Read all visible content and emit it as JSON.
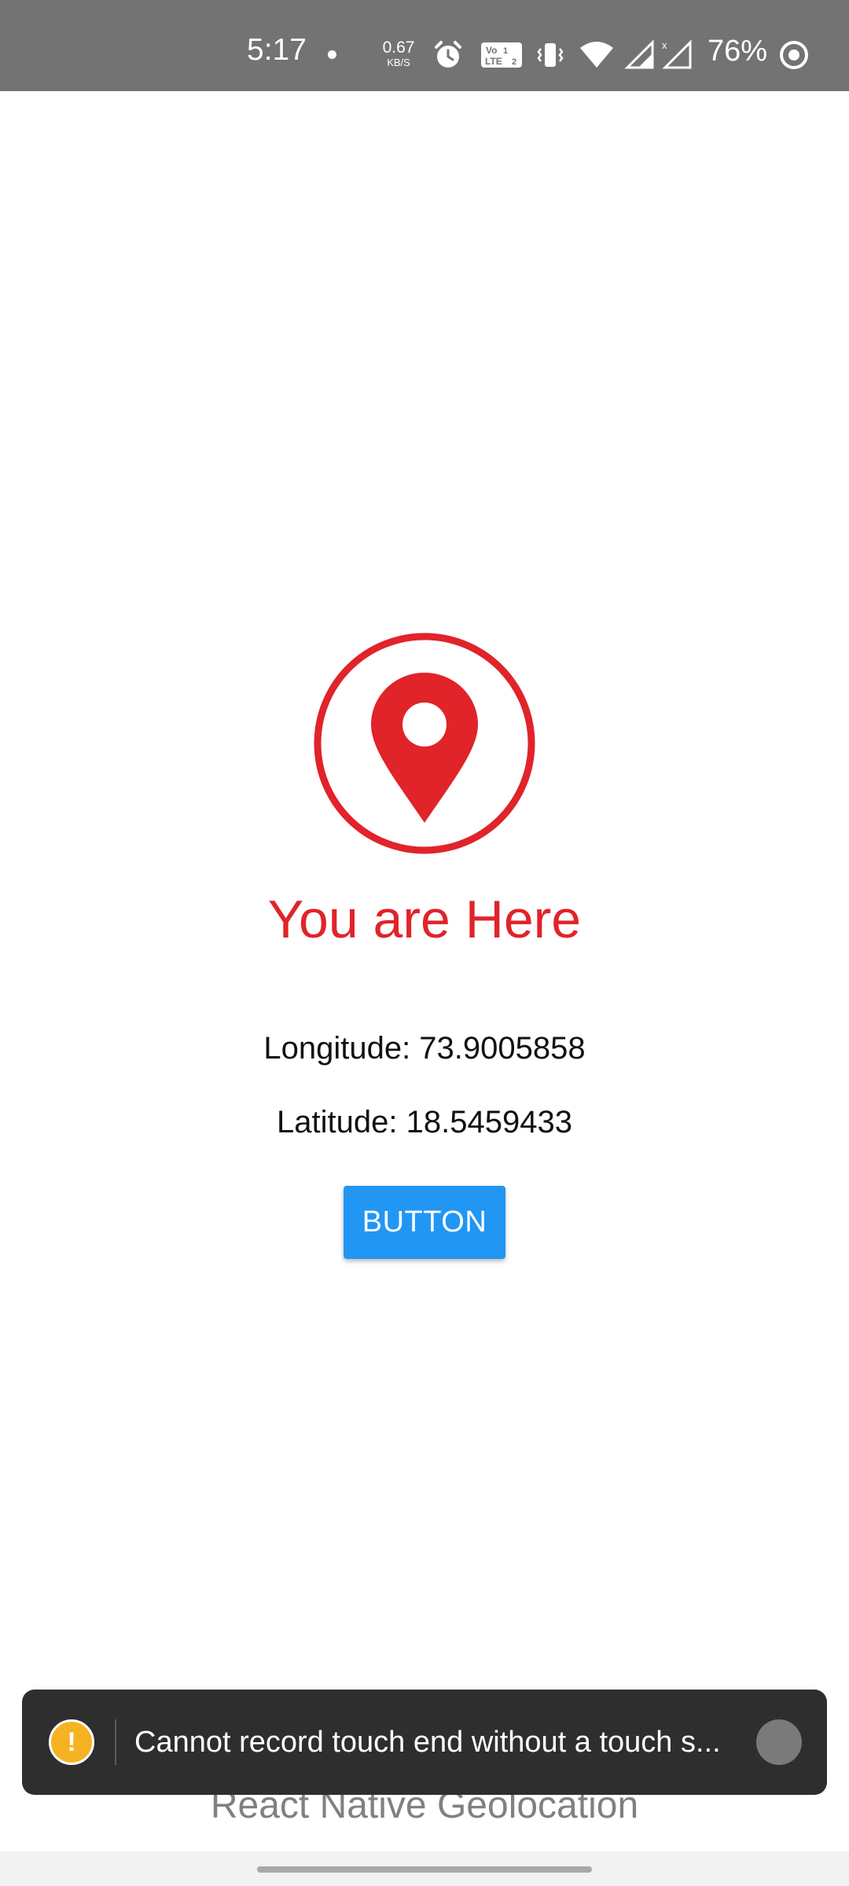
{
  "status_bar": {
    "time": "5:17",
    "net_speed_value": "0.67",
    "net_speed_unit": "KB/S",
    "battery_percent": "76%",
    "icons": [
      "notification-dot-icon",
      "alarm-icon",
      "volte-icon",
      "vibrate-icon",
      "wifi-icon",
      "signal-icon",
      "signal-no-data-icon",
      "battery-saver-icon"
    ]
  },
  "main": {
    "icon": "location-pin-icon",
    "headline": "You are Here",
    "longitude_text": "Longitude: 73.9005858",
    "latitude_text": "Latitude: 18.5459433",
    "button_label": "BUTTON"
  },
  "footer": {
    "title": "React Native Geolocation"
  },
  "warning_toast": {
    "icon": "warning-icon",
    "icon_glyph": "!",
    "message": "Cannot record touch end without a touch s..."
  },
  "colors": {
    "accent_red": "#e1232a",
    "button_blue": "#2196f3",
    "status_bar": "#737373",
    "toast_bg": "#2e2e2e",
    "warning_yellow": "#f5b324"
  }
}
